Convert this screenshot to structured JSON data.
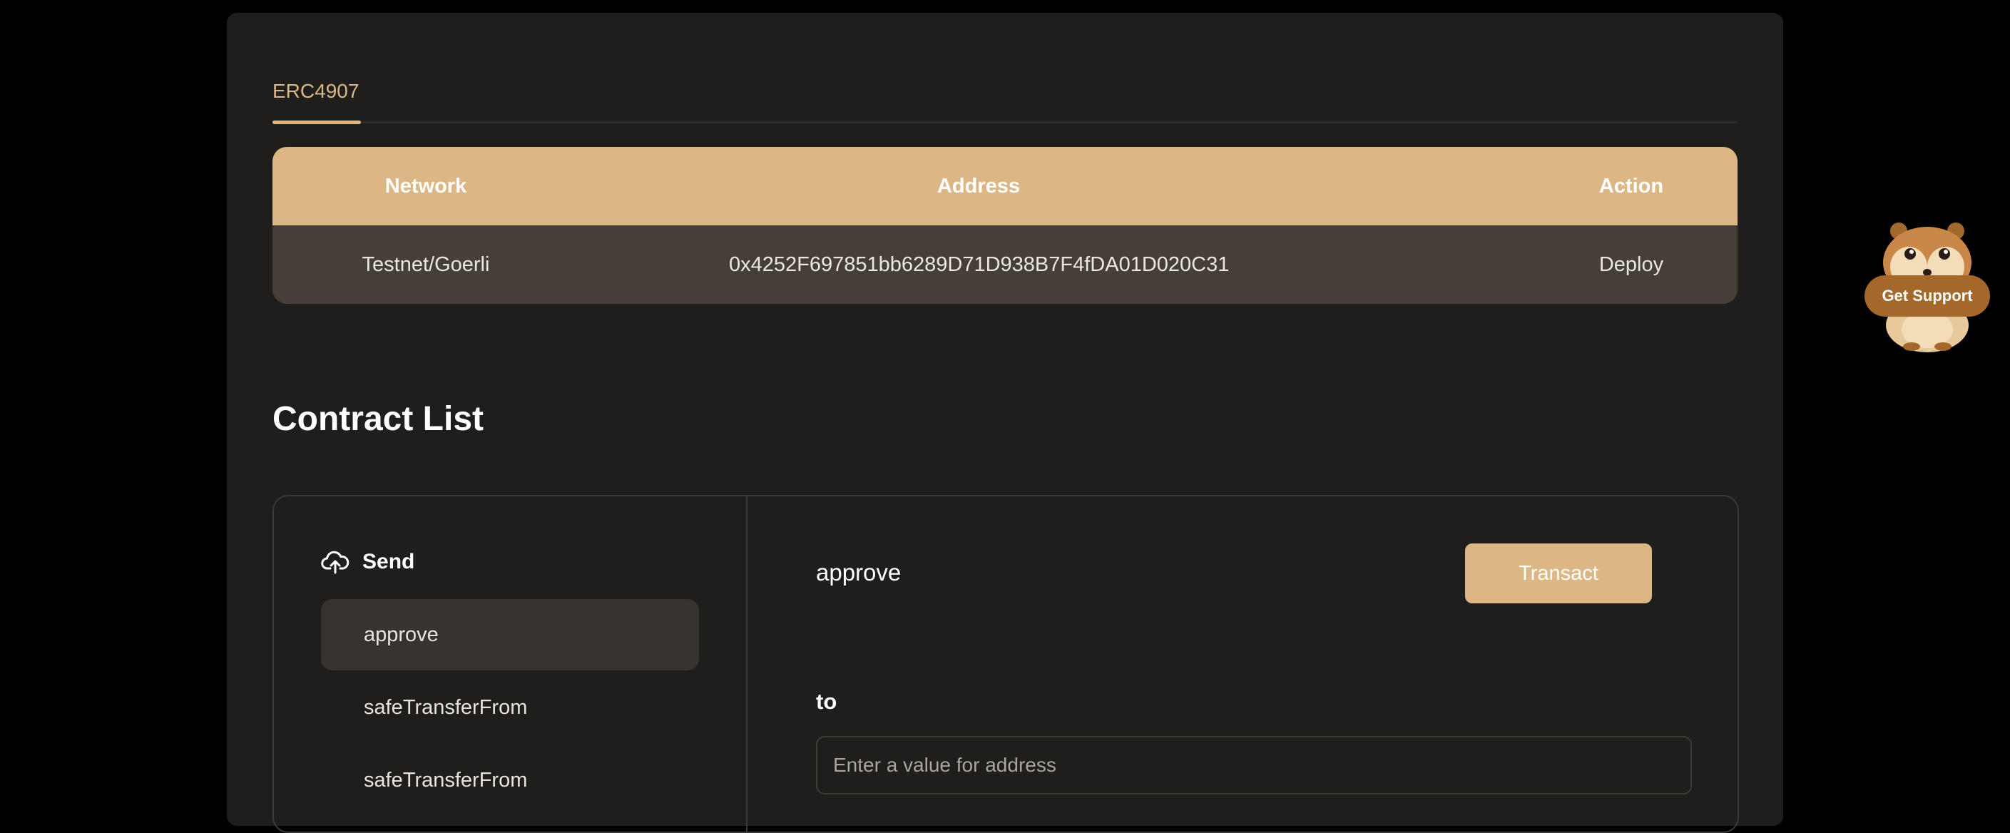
{
  "tabs": [
    {
      "label": "ERC4907"
    }
  ],
  "deploy_table": {
    "headers": {
      "network": "Network",
      "address": "Address",
      "action": "Action"
    },
    "rows": [
      {
        "network": "Testnet/Goerli",
        "address": "0x4252F697851bb6289D71D938B7F4fDA01D020C31",
        "action": "Deploy"
      }
    ]
  },
  "contract_list": {
    "title": "Contract List",
    "send_label": "Send",
    "functions": [
      "approve",
      "safeTransferFrom",
      "safeTransferFrom"
    ],
    "selected": {
      "name": "approve",
      "button": "Transact",
      "param_label": "to",
      "param_placeholder": "Enter a value for address"
    }
  },
  "support": {
    "label": "Get Support"
  },
  "colors": {
    "accent": "#dcb785",
    "card": "#1f1e1c",
    "row": "#463f38",
    "support": "#a4682b"
  }
}
